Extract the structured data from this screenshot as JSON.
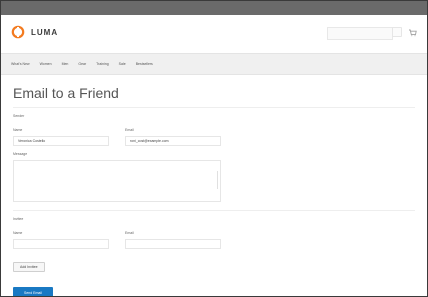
{
  "brand": {
    "name": "LUMA",
    "accent": "#f37b20",
    "primary_button": "#1979c3"
  },
  "header": {
    "search_placeholder": "",
    "icons": [
      "search-icon",
      "cart-icon"
    ]
  },
  "nav": {
    "items": [
      "What's New",
      "Women",
      "Men",
      "Gear",
      "Training",
      "Sale",
      "Bestsellers"
    ]
  },
  "page": {
    "title": "Email to a Friend"
  },
  "sender_section": {
    "title": "Sender",
    "name_label": "Name",
    "name_value": "Veronica Costello",
    "email_label": "Email",
    "email_value": "roni_cost@example.com",
    "message_label": "Message"
  },
  "invitee_section": {
    "title": "Invitee",
    "name_label": "Name",
    "email_label": "Email"
  },
  "actions": {
    "add_invitee": "Add Invitee",
    "send_email": "Send Email"
  }
}
